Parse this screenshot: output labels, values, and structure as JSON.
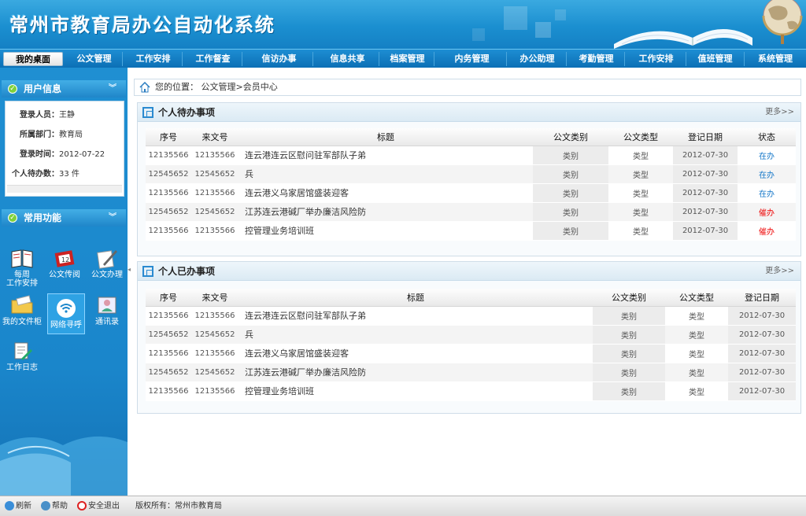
{
  "header": {
    "title": "常州市教育局办公自动化系统"
  },
  "nav": [
    {
      "label": "我的桌面",
      "active": true
    },
    {
      "label": "公文管理"
    },
    {
      "label": "工作安排"
    },
    {
      "label": "工作督查"
    },
    {
      "label": "信访办事"
    },
    {
      "label": "信息共享"
    },
    {
      "label": "档案管理"
    },
    {
      "label": "内务管理"
    },
    {
      "label": "办公助理"
    },
    {
      "label": "考勤管理"
    },
    {
      "label": "工作安排"
    },
    {
      "label": "值班管理"
    },
    {
      "label": "系统管理"
    }
  ],
  "user_panel": {
    "title": "用户信息",
    "rows": [
      {
        "label": "登录人员：",
        "value": "王静"
      },
      {
        "label": "所属部门：",
        "value": "教育局"
      },
      {
        "label": "登录时间：",
        "value": "2012-07-22"
      },
      {
        "label": "个人待办数：",
        "value": "33 件"
      }
    ]
  },
  "func_panel": {
    "title": "常用功能",
    "items": [
      {
        "label": "每周\n工作安排",
        "icon": "book-icon"
      },
      {
        "label": "公文传阅",
        "icon": "calendar-icon"
      },
      {
        "label": "公文办理",
        "icon": "pen-paper-icon"
      },
      {
        "label": "我的文件柜",
        "icon": "folder-icon"
      },
      {
        "label": "网络寻呼",
        "icon": "wifi-icon"
      },
      {
        "label": "通讯录",
        "icon": "contacts-icon"
      },
      {
        "label": "工作日志",
        "icon": "log-icon"
      }
    ]
  },
  "breadcrumb": {
    "prefix": "您的位置：",
    "path": "公文管理>会员中心"
  },
  "pending": {
    "title": "个人待办事项",
    "more": "更多>>",
    "headers": [
      "序号",
      "来文号",
      "标题",
      "公文类别",
      "公文类型",
      "登记日期",
      "状态"
    ],
    "rows": [
      {
        "no": "12135566",
        "doc": "12135566",
        "title": "连云港连云区慰问驻军部队子弟",
        "cat": "类别",
        "type": "类型",
        "date": "2012-07-30",
        "status": "在办",
        "status_color": "#1577c8"
      },
      {
        "no": "12545652",
        "doc": "12545652",
        "title": "兵",
        "cat": "类别",
        "type": "类型",
        "date": "2012-07-30",
        "status": "在办",
        "status_color": "#1577c8"
      },
      {
        "no": "12135566",
        "doc": "12135566",
        "title": "连云港义乌家居馆盛装迎客",
        "cat": "类别",
        "type": "类型",
        "date": "2012-07-30",
        "status": "在办",
        "status_color": "#1577c8"
      },
      {
        "no": "12545652",
        "doc": "12545652",
        "title": "江苏连云港碱厂举办廉洁风险防",
        "cat": "类别",
        "type": "类型",
        "date": "2012-07-30",
        "status": "催办",
        "status_color": "#e00000"
      },
      {
        "no": "12135566",
        "doc": "12135566",
        "title": "控管理业务培训班",
        "cat": "类别",
        "type": "类型",
        "date": "2012-07-30",
        "status": "催办",
        "status_color": "#e00000"
      }
    ]
  },
  "done": {
    "title": "个人已办事项",
    "more": "更多>>",
    "headers": [
      "序号",
      "来文号",
      "标题",
      "公文类别",
      "公文类型",
      "登记日期"
    ],
    "rows": [
      {
        "no": "12135566",
        "doc": "12135566",
        "title": "连云港连云区慰问驻军部队子弟",
        "cat": "类别",
        "type": "类型",
        "date": "2012-07-30"
      },
      {
        "no": "12545652",
        "doc": "12545652",
        "title": "兵",
        "cat": "类别",
        "type": "类型",
        "date": "2012-07-30"
      },
      {
        "no": "12135566",
        "doc": "12135566",
        "title": "连云港义乌家居馆盛装迎客",
        "cat": "类别",
        "type": "类型",
        "date": "2012-07-30"
      },
      {
        "no": "12545652",
        "doc": "12545652",
        "title": "江苏连云港碱厂举办廉洁风险防",
        "cat": "类别",
        "type": "类型",
        "date": "2012-07-30"
      },
      {
        "no": "12135566",
        "doc": "12135566",
        "title": "控管理业务培训班",
        "cat": "类别",
        "type": "类型",
        "date": "2012-07-30"
      }
    ]
  },
  "footer": {
    "refresh": "刷新",
    "help": "帮助",
    "logout": "安全退出",
    "copyright": "版权所有：常州市教育局"
  }
}
